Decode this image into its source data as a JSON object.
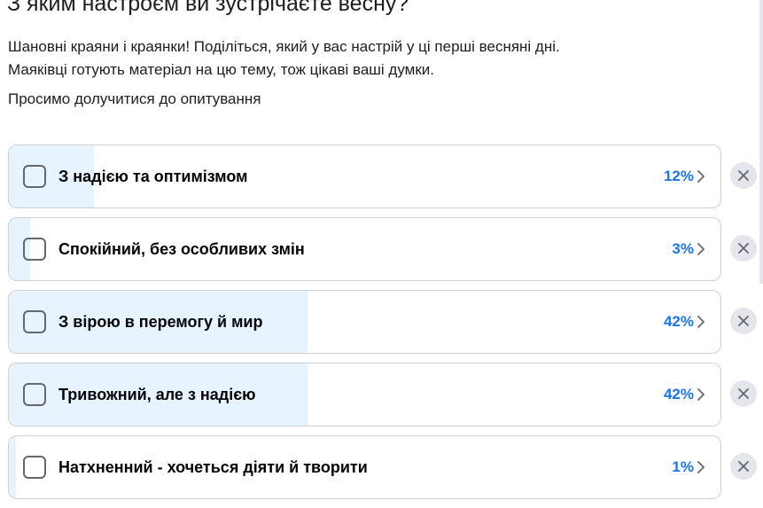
{
  "poll": {
    "title": "З яким настроєм ви зустрічаєте весну?",
    "description_line1": "Шановні краяни і краянки! Поділіться, який у вас настрій у ці перші весняні дні.",
    "description_line2": "Маяківці готують матеріал на цю тему, тож цікаві ваші думки.",
    "invite": "Просимо долучитися до опитування",
    "options": [
      {
        "label": "З надією та оптимізмом",
        "percent_text": "12%",
        "fraction": 0.12
      },
      {
        "label": "Спокійний, без особливих змін",
        "percent_text": "3%",
        "fraction": 0.03
      },
      {
        "label": "З вірою в перемогу й мир",
        "percent_text": "42%",
        "fraction": 0.42
      },
      {
        "label": "Тривожний, але з надією",
        "percent_text": "42%",
        "fraction": 0.42
      },
      {
        "label": "Натхненний - хочеться діяти й творити",
        "percent_text": "1%",
        "fraction": 0.01
      }
    ]
  },
  "icons": {
    "checkbox": "checkbox-icon",
    "chevron": "chevron-right-icon",
    "remove": "close-icon"
  },
  "colors": {
    "fill": "#e7f3ff",
    "percent": "#1b74e4",
    "border": "#ced0d4",
    "remove_bg": "#e4e6eb"
  }
}
